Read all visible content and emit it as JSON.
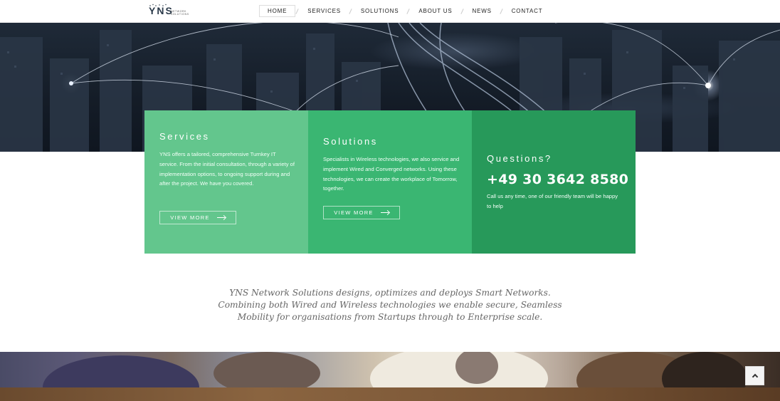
{
  "header": {
    "logo": {
      "mark": "YNS",
      "sub_line1": "NETWORK",
      "sub_line2": "SOLUTIONS"
    },
    "nav": [
      {
        "label": "HOME",
        "active": true
      },
      {
        "label": "SERVICES",
        "active": false
      },
      {
        "label": "SOLUTIONS",
        "active": false
      },
      {
        "label": "ABOUT US",
        "active": false
      },
      {
        "label": "NEWS",
        "active": false
      },
      {
        "label": "CONTACT",
        "active": false
      }
    ]
  },
  "features": {
    "services": {
      "title": "Services",
      "text": "YNS offers a tailored, comprehensive Turnkey IT service. From the initial consultation, through a variety of implementation options, to ongoing support during and after the project. We have you covered.",
      "button": "VIEW MORE"
    },
    "solutions": {
      "title": "Solutions",
      "text": "Specialists in Wireless technologies, we also service and implement Wired and Converged networks. Using these technologies, we can create the workplace of Tomorrow, together.",
      "button": "VIEW MORE"
    },
    "questions": {
      "title": "Questions?",
      "phone": "+49 30 3642 8580",
      "text": "Call us any time, one of our friendly team will be happy to help"
    }
  },
  "intro": {
    "text": "YNS Network Solutions designs, optimizes and deploys Smart Networks. Combining both Wired and Wireless technologies we enable secure, Seamless Mobility for organisations from Startups through to Enterprise scale."
  },
  "colors": {
    "services_bg": "#63c68d",
    "solutions_bg": "#3ab672",
    "questions_bg": "#27995a"
  }
}
